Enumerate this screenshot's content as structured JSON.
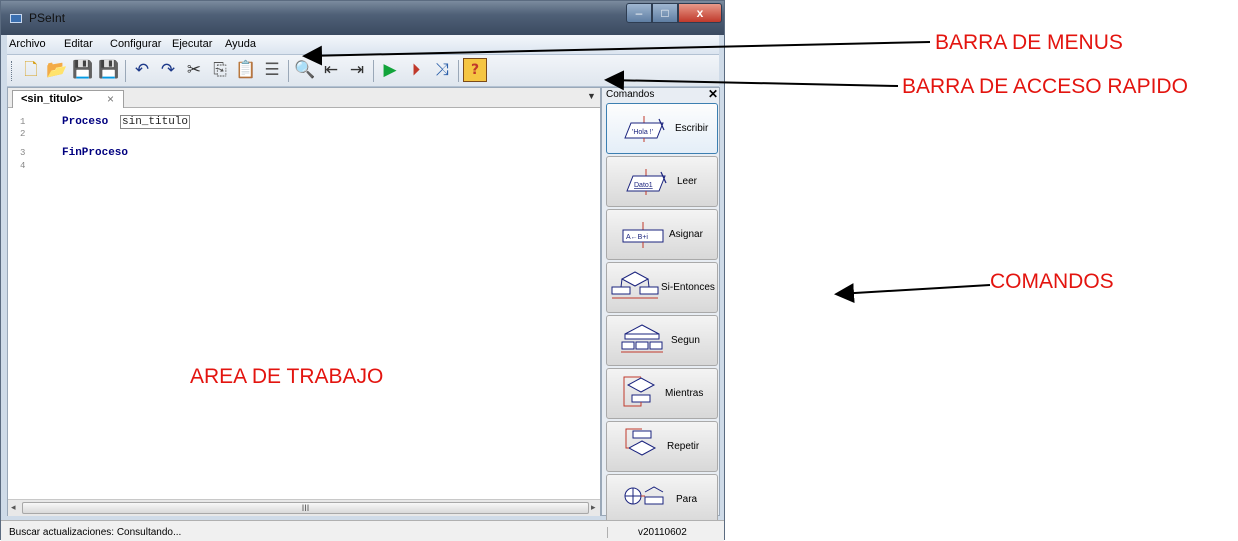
{
  "window": {
    "title": "PSeInt",
    "controls": {
      "minimize": "–",
      "maximize": "□",
      "close": "x"
    }
  },
  "menubar": {
    "items": [
      "Archivo",
      "Editar",
      "Configurar",
      "Ejecutar",
      "Ayuda"
    ]
  },
  "toolbar": {
    "buttons": [
      {
        "name": "new-file-icon",
        "glyph": "🗋",
        "color": "#d7a11b"
      },
      {
        "name": "open-file-icon",
        "glyph": "📂",
        "color": "#d9a520"
      },
      {
        "name": "save-icon",
        "glyph": "💾",
        "color": "#c0392b"
      },
      {
        "name": "save-as-icon",
        "glyph": "💾",
        "color": "#a93226"
      },
      {
        "name": "undo-icon",
        "glyph": "↶",
        "color": "#1e3a8a"
      },
      {
        "name": "redo-icon",
        "glyph": "↷",
        "color": "#1e3a8a"
      },
      {
        "name": "cut-icon",
        "glyph": "✂",
        "color": "#333333"
      },
      {
        "name": "copy-icon",
        "glyph": "⎘",
        "color": "#555555"
      },
      {
        "name": "paste-icon",
        "glyph": "📋",
        "color": "#7a5a2a"
      },
      {
        "name": "indent-icon",
        "glyph": "☰",
        "color": "#555555"
      },
      {
        "name": "find-icon",
        "glyph": "🔍",
        "color": "#333333"
      },
      {
        "name": "find-previous-icon",
        "glyph": "⇤",
        "color": "#333333"
      },
      {
        "name": "find-next-icon",
        "glyph": "⇥",
        "color": "#333333"
      },
      {
        "name": "run-icon",
        "glyph": "▶",
        "color": "#12a43a"
      },
      {
        "name": "step-run-icon",
        "glyph": "⏵",
        "color": "#c0392b"
      },
      {
        "name": "flowchart-icon",
        "glyph": "⤨",
        "color": "#2a5ea8"
      },
      {
        "name": "help-icon",
        "glyph": "?",
        "color": "#c0392b"
      }
    ]
  },
  "editor": {
    "tab_label": "<sin_titulo>",
    "tab_close": "×",
    "tab_menu": "▼",
    "lines": [
      {
        "num": "1",
        "keyword": "Proceso",
        "ident": "sin_titulo"
      },
      {
        "num": "2",
        "keyword": "",
        "ident": ""
      },
      {
        "num": "3",
        "keyword": "FinProceso",
        "ident": ""
      },
      {
        "num": "4",
        "keyword": "",
        "ident": ""
      }
    ],
    "scroll_left": "◂",
    "scroll_right": "▸",
    "scroll_grip": "III"
  },
  "commands_panel": {
    "title": "Comandos",
    "close": "✕",
    "buttons": [
      {
        "label": "Escribir",
        "icon_text": "'Hola !'",
        "selected": true
      },
      {
        "label": "Leer",
        "icon_text": "Dato1",
        "selected": false
      },
      {
        "label": "Asignar",
        "icon_text": "A←B+i",
        "selected": false
      },
      {
        "label": "Si-Entonces",
        "icon_text": "",
        "selected": false
      },
      {
        "label": "Segun",
        "icon_text": "",
        "selected": false
      },
      {
        "label": "Mientras",
        "icon_text": "",
        "selected": false
      },
      {
        "label": "Repetir",
        "icon_text": "",
        "selected": false
      },
      {
        "label": "Para",
        "icon_text": "",
        "selected": false
      }
    ]
  },
  "statusbar": {
    "text": "Buscar actualizaciones: Consultando...",
    "version": "v20110602"
  },
  "annotations": {
    "menus": "BARRA DE MENUS",
    "quick_access": "BARRA DE ACCESO RAPIDO",
    "commands": "COMANDOS",
    "work_area": "AREA DE TRABAJO",
    "color": "#e3140f"
  }
}
